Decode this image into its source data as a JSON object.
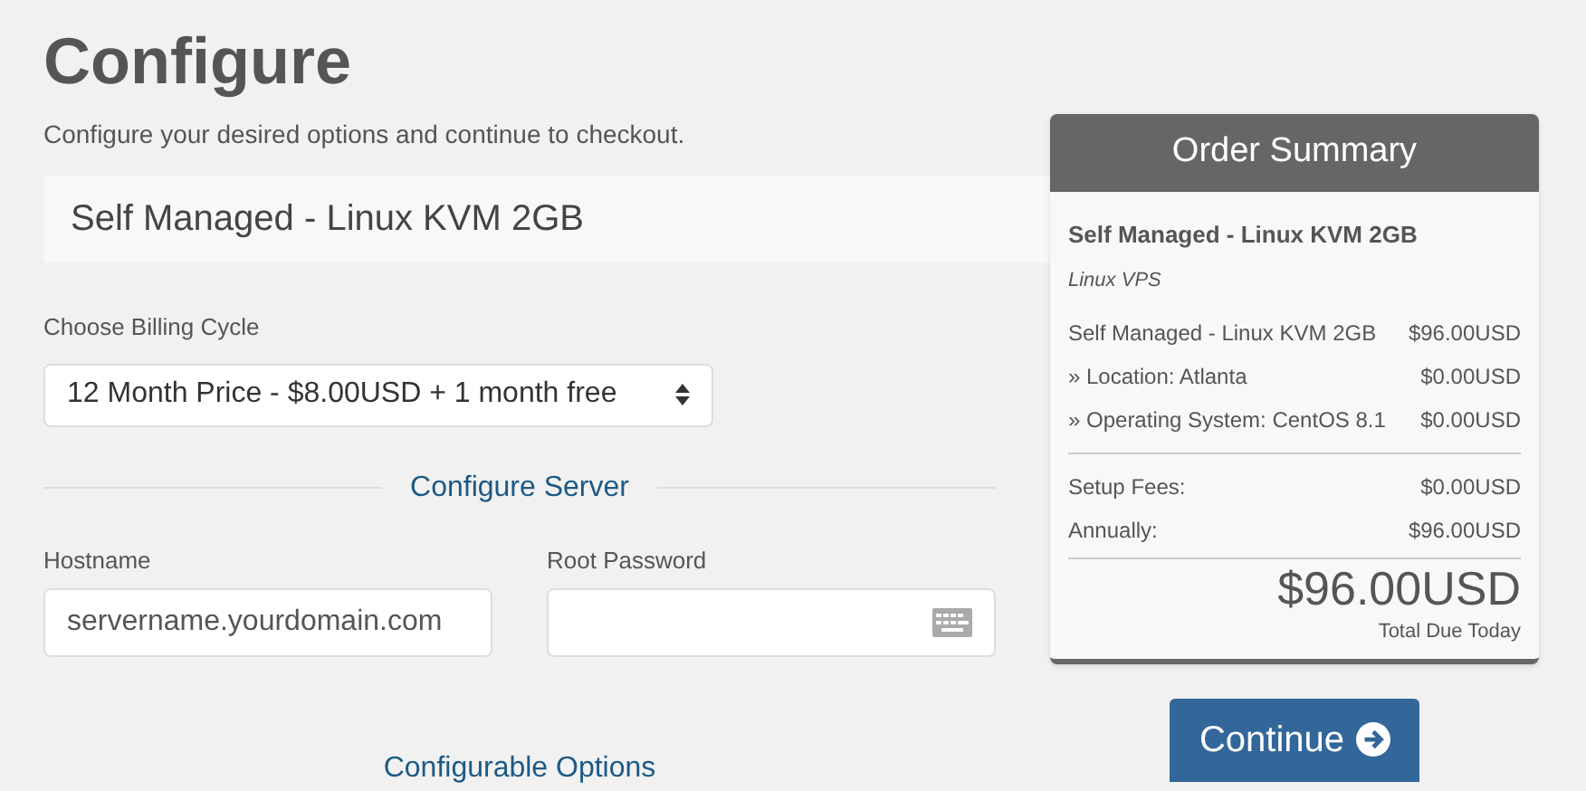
{
  "header": {
    "title": "Configure",
    "subtitle": "Configure your desired options and continue to checkout."
  },
  "product": {
    "name": "Self Managed - Linux KVM 2GB"
  },
  "billing": {
    "label": "Choose Billing Cycle",
    "value": "12 Month Price - $8.00USD + 1 month free"
  },
  "section_title": "Configure Server",
  "fields": [
    {
      "label": "Hostname",
      "placeholder": "servername.yourdomain.com",
      "kind": "text"
    },
    {
      "label": "Root Password",
      "kind": "password"
    }
  ],
  "next_section_title": "Configurable Options",
  "order_summary": {
    "title": "Order Summary",
    "product": "Self Managed - Linux KVM 2GB",
    "group": "Linux VPS",
    "lines": [
      {
        "label": "Self Managed - Linux KVM 2GB",
        "amount": "$96.00USD"
      },
      {
        "label": "» Location: Atlanta",
        "amount": "$0.00USD"
      },
      {
        "label": "» Operating System: CentOS 8.1",
        "amount": "$0.00USD"
      }
    ],
    "fees": [
      {
        "label": "Setup Fees:",
        "amount": "$0.00USD"
      },
      {
        "label": "Annually:",
        "amount": "$96.00USD"
      }
    ],
    "total": "$96.00USD",
    "total_label": "Total Due Today"
  },
  "continue_button": "Continue"
}
